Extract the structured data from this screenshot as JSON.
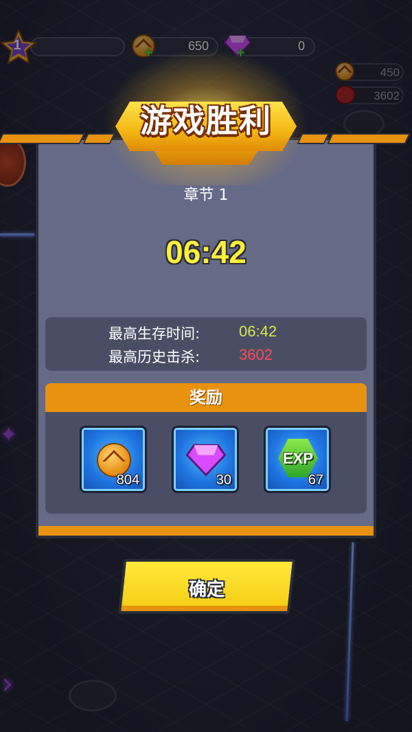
{
  "hud": {
    "player_level": "1",
    "coins": "650",
    "gems": "0",
    "run_coins": "450",
    "run_kills": "3602",
    "icons": [
      "level-star-icon",
      "coin-icon",
      "gem-icon",
      "plus-icon",
      "skull-icon",
      "treasure-chest-icon"
    ]
  },
  "result": {
    "title": "游戏胜利",
    "chapter_label": "章节 1",
    "survival_time": "06:42"
  },
  "stats": {
    "best_time_label": "最高生存时间:",
    "best_time_value": "06:42",
    "best_kills_label": "最高历史击杀:",
    "best_kills_value": "3602"
  },
  "rewards": {
    "header": "奖励",
    "items": [
      {
        "icon": "coin-icon",
        "count": "804"
      },
      {
        "icon": "gem-icon",
        "count": "30"
      },
      {
        "icon": "exp-icon",
        "label": "EXP",
        "count": "67"
      }
    ]
  },
  "confirm_label": "确定",
  "colors": {
    "accent_orange": "#e8920f",
    "timer_yellow": "#ffef3a",
    "time_value_color": "#d6e64a",
    "kills_value_color": "#ff4a5a",
    "panel": "#656a86",
    "reward_card_blue": "#1f74e0",
    "button_yellow": "#ffe93a"
  }
}
